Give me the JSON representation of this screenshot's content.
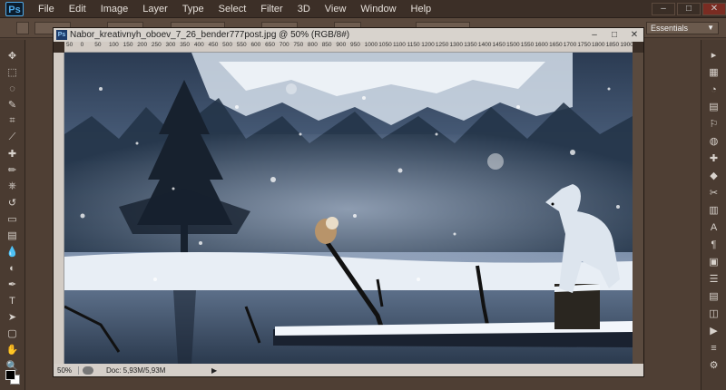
{
  "app": {
    "logo": "Ps",
    "menu": [
      "File",
      "Edit",
      "Image",
      "Layer",
      "Type",
      "Select",
      "Filter",
      "3D",
      "View",
      "Window",
      "Help"
    ],
    "window_controls": {
      "minimize": "–",
      "maximize": "□",
      "close": "✕"
    }
  },
  "options_bar": {
    "workspace": "Essentials"
  },
  "document": {
    "title": "Nabor_kreativnyh_oboev_7_26_bender777post.jpg @ 50% (RGB/8#)",
    "icon_label": "Ps",
    "controls": {
      "minimize": "–",
      "maximize": "□",
      "close": "✕"
    },
    "ruler_ticks": [
      "50",
      "0",
      "50",
      "100",
      "150",
      "200",
      "250",
      "300",
      "350",
      "400",
      "450",
      "500",
      "550",
      "600",
      "650",
      "700",
      "750",
      "800",
      "850",
      "900",
      "950",
      "1000",
      "1050",
      "1100",
      "1150",
      "1200",
      "1250",
      "1300",
      "1350",
      "1400",
      "1450",
      "1500",
      "1550",
      "1600",
      "1650",
      "1700",
      "1750",
      "1800",
      "1850",
      "1900"
    ],
    "status": {
      "zoom": "50%",
      "doc_size": "Doc: 5,93M/5,93M"
    }
  },
  "tools": [
    "move-icon",
    "marquee-icon",
    "lasso-icon",
    "quick-select-icon",
    "crop-icon",
    "eyedropper-icon",
    "healing-icon",
    "brush-icon",
    "clone-stamp-icon",
    "history-brush-icon",
    "eraser-icon",
    "gradient-icon",
    "blur-icon",
    "dodge-icon",
    "pen-icon",
    "type-icon",
    "path-select-icon",
    "rectangle-icon",
    "hand-icon",
    "zoom-icon"
  ],
  "tool_glyphs": [
    "✥",
    "⬚",
    "◌",
    "✎",
    "⌗",
    "⟋",
    "✚",
    "✏",
    "⎈",
    "↺",
    "▭",
    "▤",
    "💧",
    "◐",
    "✒",
    "T",
    "➤",
    "▢",
    "✋",
    "🔍"
  ],
  "dock_glyphs": [
    "▸",
    "▦",
    "◔",
    "▤",
    "⚐",
    "◍",
    "✚",
    "◆",
    "✂",
    "▥",
    "A",
    "¶",
    "▣",
    "☰",
    "▤",
    "◫",
    "▶",
    "≡",
    "⚙"
  ],
  "colors": {
    "foreground": "#000000",
    "background": "#ffffff",
    "accent": "#4fa9e8"
  }
}
